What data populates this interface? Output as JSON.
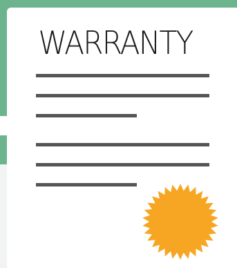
{
  "document": {
    "title": "WARRANTY",
    "colors": {
      "accent_green": "#6cb48e",
      "line_grey": "#555555",
      "seal_orange": "#f6a623",
      "text_dark": "#1a1a1a"
    },
    "seal_icon": "starburst-seal-icon"
  }
}
